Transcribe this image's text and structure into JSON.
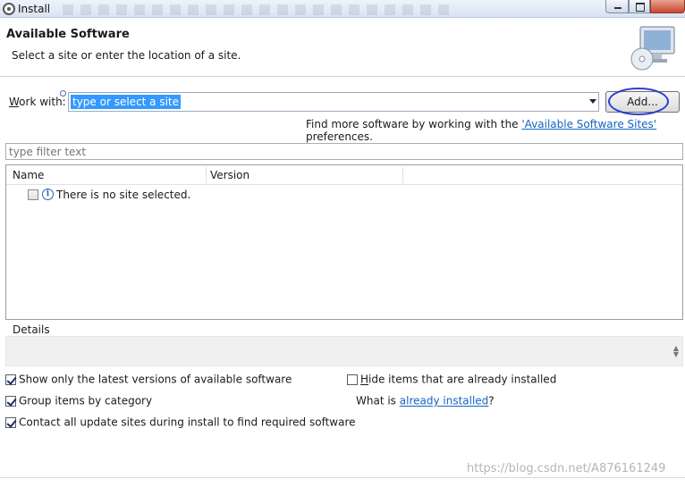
{
  "window": {
    "title": "Install"
  },
  "banner": {
    "title": "Available Software",
    "description": "Select a site or enter the location of a site."
  },
  "work_with": {
    "label_mnemonic": "W",
    "label_rest": "ork with:",
    "value": "type or select a site",
    "add_button": "Add...",
    "more_prefix": "Find more software by working with the ",
    "more_link": "'Available Software Sites'",
    "more_suffix": " preferences."
  },
  "filter": {
    "placeholder": "type filter text"
  },
  "tree": {
    "columns": [
      "Name",
      "Version"
    ],
    "message": "There is no site selected."
  },
  "details": {
    "label": "Details"
  },
  "options": {
    "show_latest": {
      "label": "Show only the latest versions of available software",
      "checked": true
    },
    "group_by_category": {
      "label": "Group items by category",
      "checked": true
    },
    "contact_sites": {
      "label": "Contact all update sites during install to find required software",
      "checked": true
    },
    "hide_installed": {
      "label_mnemonic": "H",
      "label_rest": "ide items that are already installed",
      "checked": false
    },
    "installed_prefix": "What is ",
    "installed_link": "already installed",
    "installed_suffix": "?"
  },
  "watermark": "https://blog.csdn.net/A876161249",
  "colors": {
    "selection": "#3399ff",
    "link": "#1565c0",
    "highlight_ring": "#2a3fd0"
  }
}
